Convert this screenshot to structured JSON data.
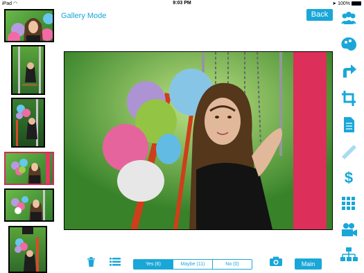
{
  "status": {
    "device": "iPad",
    "time": "9:03 PM",
    "battery": "100%"
  },
  "header": {
    "title": "Gallery Mode",
    "back_label": "Back"
  },
  "filter": {
    "yes": "Yes (6)",
    "maybe": "Maybe (11)",
    "no": "No (0)"
  },
  "footer": {
    "main_label": "Main"
  },
  "colors": {
    "accent": "#19a7d8",
    "selected_thumb": "#d42b5a"
  },
  "sidebar_icons": [
    "people-icon",
    "palette-icon",
    "share-arrow-icon",
    "crop-icon",
    "document-icon",
    "ruler-icon",
    "dollar-icon",
    "grid-icon",
    "video-camera-icon",
    "folder-tree-icon"
  ]
}
